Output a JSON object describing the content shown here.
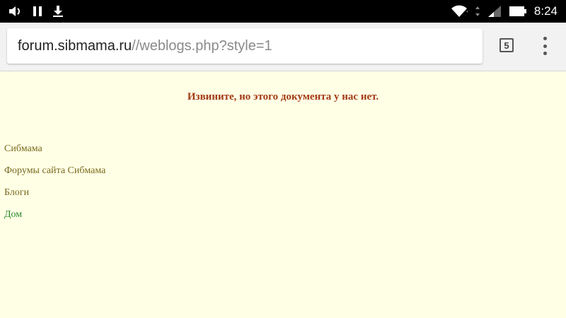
{
  "status_bar": {
    "time": "8:24",
    "icons": [
      "volume-icon",
      "pause-icon",
      "download-icon",
      "wifi-icon",
      "signal-icon",
      "battery-icon"
    ]
  },
  "browser": {
    "url_host": "forum.sibmama.ru",
    "url_path": "//weblogs.php?style=1",
    "tab_count": "5"
  },
  "page": {
    "error_message": "Извините, но этого документа у нас нет.",
    "nav": [
      {
        "label": "Сибмама"
      },
      {
        "label": "Форумы сайта Сибмама"
      },
      {
        "label": "Блоги"
      },
      {
        "label": "Дом"
      }
    ]
  },
  "colors": {
    "page_background": "#ffffe6",
    "error_text": "#a33a14",
    "link_text": "#7a6a1d",
    "current_link_text": "#2b8a2b"
  }
}
